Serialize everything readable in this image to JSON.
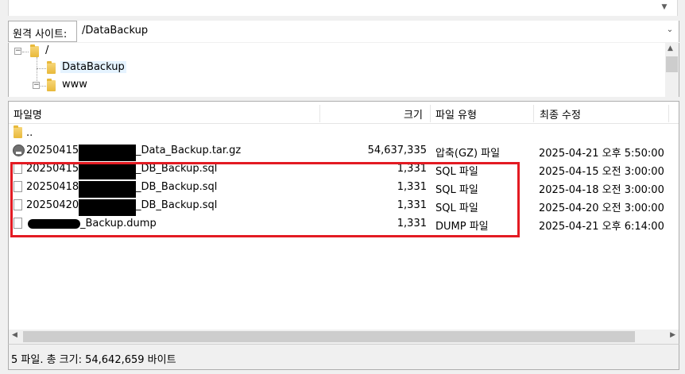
{
  "remote_site": {
    "label": "원격 사이트:",
    "path": "/DataBackup"
  },
  "tree": {
    "items": [
      {
        "label": "/"
      },
      {
        "label": "DataBackup"
      },
      {
        "label": "www"
      }
    ]
  },
  "columns": {
    "name": "파일명",
    "size": "크기",
    "type": "파일 유형",
    "modified": "최종 수정"
  },
  "files": [
    {
      "name": "..",
      "size": "",
      "type": "",
      "modified": ""
    },
    {
      "name_prefix": "20250415",
      "name_suffix": "_Data_Backup.tar.gz",
      "size": "54,637,335",
      "type": "압축(GZ) 파일",
      "modified": "2025-04-21 오후 5:50:00"
    },
    {
      "name_prefix": "20250415",
      "name_suffix": "_DB_Backup.sql",
      "size": "1,331",
      "type": "SQL 파일",
      "modified": "2025-04-15 오전 3:00:00"
    },
    {
      "name_prefix": "20250418",
      "name_suffix": "_DB_Backup.sql",
      "size": "1,331",
      "type": "SQL 파일",
      "modified": "2025-04-18 오전 3:00:00"
    },
    {
      "name_prefix": "20250420",
      "name_suffix": "_DB_Backup.sql",
      "size": "1,331",
      "type": "SQL 파일",
      "modified": "2025-04-20 오전 3:00:00"
    },
    {
      "name_prefix": "",
      "name_suffix": "_Backup.dump",
      "size": "1,331",
      "type": "DUMP 파일",
      "modified": "2025-04-21 오후 6:14:00"
    }
  ],
  "status": {
    "text": "5 파일. 총 크기: 54,642,659 바이트"
  },
  "colors": {
    "highlight": "#e31b23",
    "selection": "#e5f3ff"
  },
  "icons": [
    "folder-icon",
    "archive-icon",
    "file-icon",
    "chevron-down-icon",
    "collapse-icon"
  ]
}
